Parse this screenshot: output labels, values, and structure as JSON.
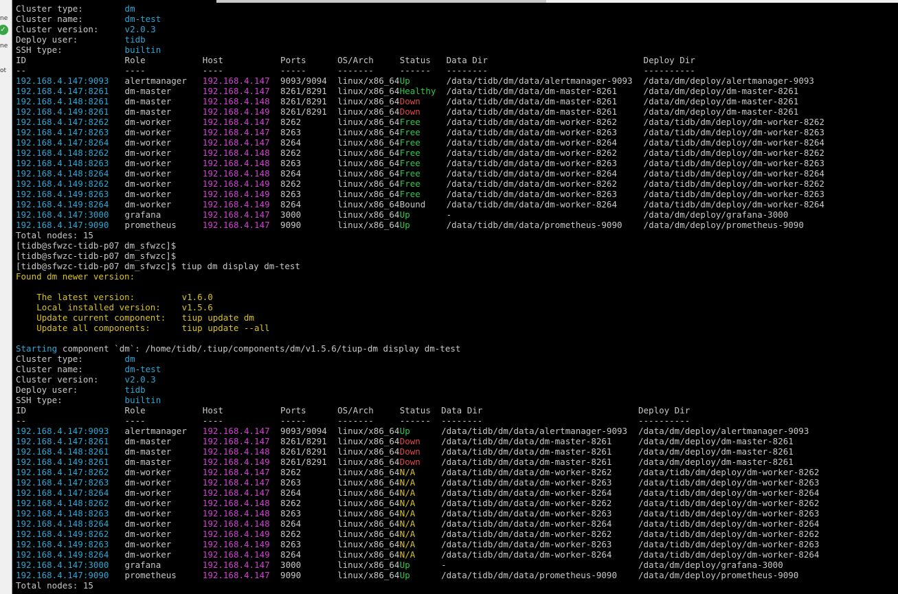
{
  "sidebar": {
    "fragment1": "ne",
    "fragment2": "ot"
  },
  "block1": {
    "info": [
      {
        "label": "Cluster type:",
        "value": "dm"
      },
      {
        "label": "Cluster name:",
        "value": "dm-test"
      },
      {
        "label": "Cluster version:",
        "value": "v2.0.3"
      },
      {
        "label": "Deploy user:",
        "value": "tidb"
      },
      {
        "label": "SSH type:",
        "value": "builtin"
      }
    ],
    "headers": [
      "ID",
      "Role",
      "Host",
      "Ports",
      "OS/Arch",
      "Status",
      "Data Dir",
      "Deploy Dir"
    ],
    "separators": [
      "--",
      "----",
      "----",
      "-----",
      "-------",
      "------",
      "--------",
      "----------"
    ],
    "rows": [
      [
        "192.168.4.147:9093",
        "alertmanager",
        "192.168.4.147",
        "9093/9094",
        "linux/x86_64",
        "Up",
        "/data/tidb/dm/data/alertmanager-9093",
        "/data/dm/deploy/alertmanager-9093"
      ],
      [
        "192.168.4.147:8261",
        "dm-master",
        "192.168.4.147",
        "8261/8291",
        "linux/x86_64",
        "Healthy",
        "/data/tidb/dm/data/dm-master-8261",
        "/data/dm/deploy/dm-master-8261"
      ],
      [
        "192.168.4.148:8261",
        "dm-master",
        "192.168.4.148",
        "8261/8291",
        "linux/x86_64",
        "Down",
        "/data/tidb/dm/data/dm-master-8261",
        "/data/dm/deploy/dm-master-8261"
      ],
      [
        "192.168.4.149:8261",
        "dm-master",
        "192.168.4.149",
        "8261/8291",
        "linux/x86_64",
        "Down",
        "/data/tidb/dm/data/dm-master-8261",
        "/data/dm/deploy/dm-master-8261"
      ],
      [
        "192.168.4.147:8262",
        "dm-worker",
        "192.168.4.147",
        "8262",
        "linux/x86_64",
        "Free",
        "/data/tidb/dm/data/dm-worker-8262",
        "/data/tidb/dm/deploy/dm-worker-8262"
      ],
      [
        "192.168.4.147:8263",
        "dm-worker",
        "192.168.4.147",
        "8263",
        "linux/x86_64",
        "Free",
        "/data/tidb/dm/data/dm-worker-8263",
        "/data/tidb/dm/deploy/dm-worker-8263"
      ],
      [
        "192.168.4.147:8264",
        "dm-worker",
        "192.168.4.147",
        "8264",
        "linux/x86_64",
        "Free",
        "/data/tidb/dm/data/dm-worker-8264",
        "/data/tidb/dm/deploy/dm-worker-8264"
      ],
      [
        "192.168.4.148:8262",
        "dm-worker",
        "192.168.4.148",
        "8262",
        "linux/x86_64",
        "Free",
        "/data/tidb/dm/data/dm-worker-8262",
        "/data/tidb/dm/deploy/dm-worker-8262"
      ],
      [
        "192.168.4.148:8263",
        "dm-worker",
        "192.168.4.148",
        "8263",
        "linux/x86_64",
        "Free",
        "/data/tidb/dm/data/dm-worker-8263",
        "/data/tidb/dm/deploy/dm-worker-8263"
      ],
      [
        "192.168.4.148:8264",
        "dm-worker",
        "192.168.4.148",
        "8264",
        "linux/x86_64",
        "Free",
        "/data/tidb/dm/data/dm-worker-8264",
        "/data/tidb/dm/deploy/dm-worker-8264"
      ],
      [
        "192.168.4.149:8262",
        "dm-worker",
        "192.168.4.149",
        "8262",
        "linux/x86_64",
        "Free",
        "/data/tidb/dm/data/dm-worker-8262",
        "/data/tidb/dm/deploy/dm-worker-8262"
      ],
      [
        "192.168.4.149:8263",
        "dm-worker",
        "192.168.4.149",
        "8263",
        "linux/x86_64",
        "Free",
        "/data/tidb/dm/data/dm-worker-8263",
        "/data/tidb/dm/deploy/dm-worker-8263"
      ],
      [
        "192.168.4.149:8264",
        "dm-worker",
        "192.168.4.149",
        "8264",
        "linux/x86_64",
        "Bound",
        "/data/tidb/dm/data/dm-worker-8264",
        "/data/tidb/dm/deploy/dm-worker-8264"
      ],
      [
        "192.168.4.147:3000",
        "grafana",
        "192.168.4.147",
        "3000",
        "linux/x86_64",
        "Up",
        "-",
        "/data/dm/deploy/grafana-3000"
      ],
      [
        "192.168.4.147:9090",
        "prometheus",
        "192.168.4.147",
        "9090",
        "linux/x86_64",
        "Up",
        "/data/tidb/dm/data/prometheus-9090",
        "/data/dm/deploy/prometheus-9090"
      ]
    ],
    "total": "Total nodes: 15"
  },
  "prompts": [
    "[tidb@sfwzc-tidb-p07 dm_sfwzc]$",
    "[tidb@sfwzc-tidb-p07 dm_sfwzc]$",
    "[tidb@sfwzc-tidb-p07 dm_sfwzc]$ tiup dm display dm-test"
  ],
  "update_notice": {
    "title": "Found dm newer version:",
    "lines": [
      {
        "label": "The latest version:",
        "value": "v1.6.0"
      },
      {
        "label": "Local installed version:",
        "value": "v1.5.6"
      },
      {
        "label": "Update current component:",
        "value": "tiup update dm"
      },
      {
        "label": "Update all components:",
        "value": "tiup update --all"
      }
    ]
  },
  "starting": {
    "word": "Starting",
    "rest": " component `dm`: /home/tidb/.tiup/components/dm/v1.5.6/tiup-dm display dm-test"
  },
  "block2": {
    "info": [
      {
        "label": "Cluster type:",
        "value": "dm"
      },
      {
        "label": "Cluster name:",
        "value": "dm-test"
      },
      {
        "label": "Cluster version:",
        "value": "v2.0.3"
      },
      {
        "label": "Deploy user:",
        "value": "tidb"
      },
      {
        "label": "SSH type:",
        "value": "builtin"
      }
    ],
    "headers": [
      "ID",
      "Role",
      "Host",
      "Ports",
      "OS/Arch",
      "Status",
      "Data Dir",
      "Deploy Dir"
    ],
    "separators": [
      "--",
      "----",
      "----",
      "-----",
      "-------",
      "------",
      "--------",
      "----------"
    ],
    "rows": [
      [
        "192.168.4.147:9093",
        "alertmanager",
        "192.168.4.147",
        "9093/9094",
        "linux/x86_64",
        "Up",
        "/data/tidb/dm/data/alertmanager-9093",
        "/data/dm/deploy/alertmanager-9093"
      ],
      [
        "192.168.4.147:8261",
        "dm-master",
        "192.168.4.147",
        "8261/8291",
        "linux/x86_64",
        "Down",
        "/data/tidb/dm/data/dm-master-8261",
        "/data/dm/deploy/dm-master-8261"
      ],
      [
        "192.168.4.148:8261",
        "dm-master",
        "192.168.4.148",
        "8261/8291",
        "linux/x86_64",
        "Down",
        "/data/tidb/dm/data/dm-master-8261",
        "/data/dm/deploy/dm-master-8261"
      ],
      [
        "192.168.4.149:8261",
        "dm-master",
        "192.168.4.149",
        "8261/8291",
        "linux/x86_64",
        "Down",
        "/data/tidb/dm/data/dm-master-8261",
        "/data/dm/deploy/dm-master-8261"
      ],
      [
        "192.168.4.147:8262",
        "dm-worker",
        "192.168.4.147",
        "8262",
        "linux/x86_64",
        "N/A",
        "/data/tidb/dm/data/dm-worker-8262",
        "/data/tidb/dm/deploy/dm-worker-8262"
      ],
      [
        "192.168.4.147:8263",
        "dm-worker",
        "192.168.4.147",
        "8263",
        "linux/x86_64",
        "N/A",
        "/data/tidb/dm/data/dm-worker-8263",
        "/data/tidb/dm/deploy/dm-worker-8263"
      ],
      [
        "192.168.4.147:8264",
        "dm-worker",
        "192.168.4.147",
        "8264",
        "linux/x86_64",
        "N/A",
        "/data/tidb/dm/data/dm-worker-8264",
        "/data/tidb/dm/deploy/dm-worker-8264"
      ],
      [
        "192.168.4.148:8262",
        "dm-worker",
        "192.168.4.148",
        "8262",
        "linux/x86_64",
        "N/A",
        "/data/tidb/dm/data/dm-worker-8262",
        "/data/tidb/dm/deploy/dm-worker-8262"
      ],
      [
        "192.168.4.148:8263",
        "dm-worker",
        "192.168.4.148",
        "8263",
        "linux/x86_64",
        "N/A",
        "/data/tidb/dm/data/dm-worker-8263",
        "/data/tidb/dm/deploy/dm-worker-8263"
      ],
      [
        "192.168.4.148:8264",
        "dm-worker",
        "192.168.4.148",
        "8264",
        "linux/x86_64",
        "N/A",
        "/data/tidb/dm/data/dm-worker-8264",
        "/data/tidb/dm/deploy/dm-worker-8264"
      ],
      [
        "192.168.4.149:8262",
        "dm-worker",
        "192.168.4.149",
        "8262",
        "linux/x86_64",
        "N/A",
        "/data/tidb/dm/data/dm-worker-8262",
        "/data/tidb/dm/deploy/dm-worker-8262"
      ],
      [
        "192.168.4.149:8263",
        "dm-worker",
        "192.168.4.149",
        "8263",
        "linux/x86_64",
        "N/A",
        "/data/tidb/dm/data/dm-worker-8263",
        "/data/tidb/dm/deploy/dm-worker-8263"
      ],
      [
        "192.168.4.149:8264",
        "dm-worker",
        "192.168.4.149",
        "8264",
        "linux/x86_64",
        "N/A",
        "/data/tidb/dm/data/dm-worker-8264",
        "/data/tidb/dm/deploy/dm-worker-8264"
      ],
      [
        "192.168.4.147:3000",
        "grafana",
        "192.168.4.147",
        "3000",
        "linux/x86_64",
        "Up",
        "-",
        "/data/dm/deploy/grafana-3000"
      ],
      [
        "192.168.4.147:9090",
        "prometheus",
        "192.168.4.147",
        "9090",
        "linux/x86_64",
        "Up",
        "/data/tidb/dm/data/prometheus-9090",
        "/data/dm/deploy/prometheus-9090"
      ]
    ],
    "total": "Total nodes: 15"
  },
  "status_colors": {
    "Up": "#2fc84a",
    "Healthy": "#2fc84a",
    "Free": "#2fc84a",
    "Down": "#e04848",
    "N/A": "#d8c21c",
    "Bound": "#c8c8c8"
  },
  "colors": {
    "background": "#000000",
    "text": "#c8c8c8",
    "id": "#29a8d6",
    "host": "#d43ed4",
    "info_value": "#29a8d6",
    "notice": "#d8c21c"
  }
}
